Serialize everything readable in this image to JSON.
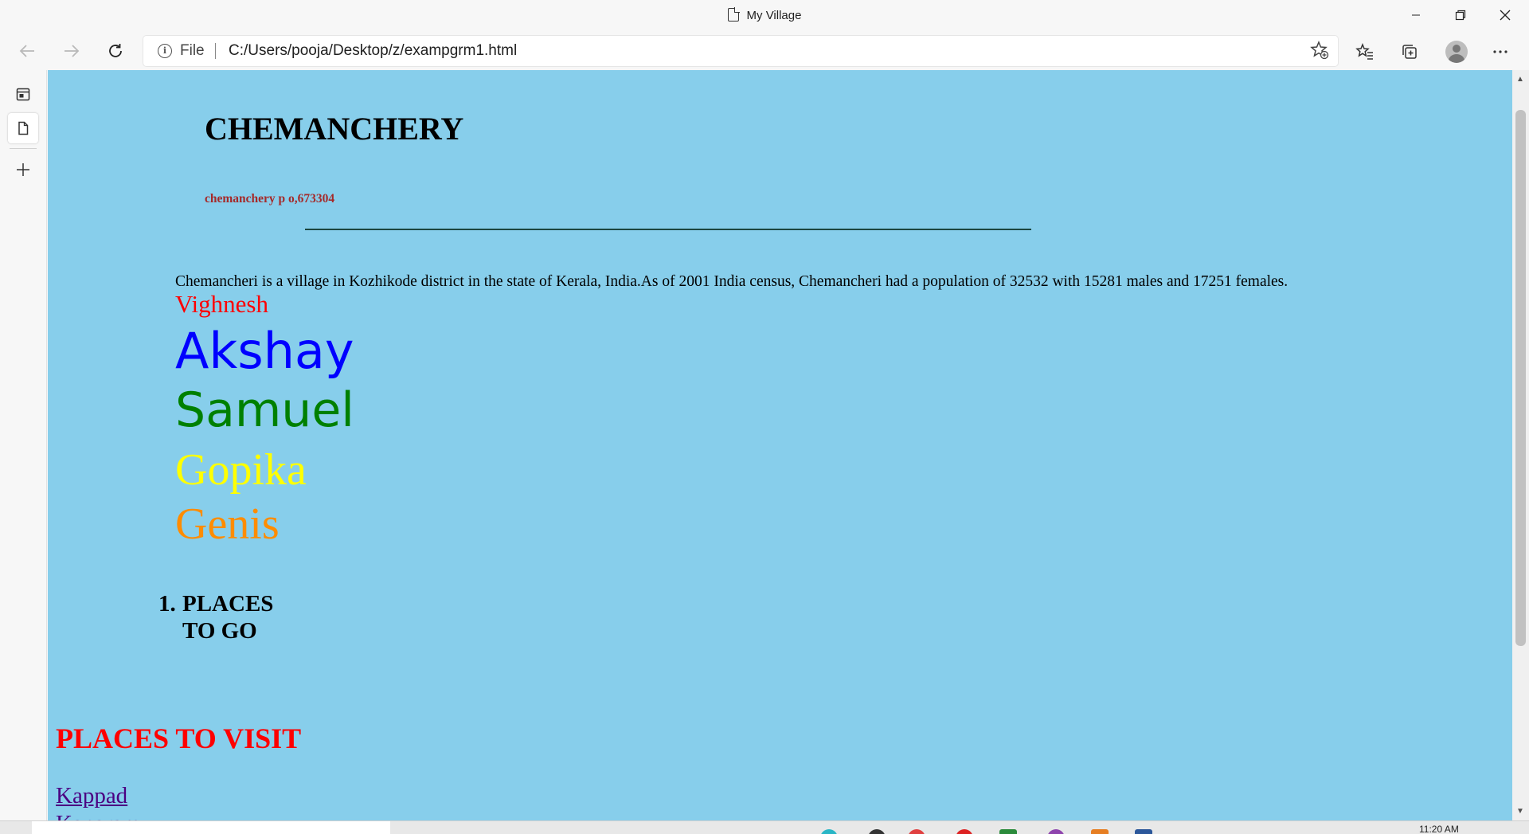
{
  "window": {
    "title": "My Village",
    "minimize_icon": "minimize-icon",
    "restore_icon": "restore-icon",
    "close_icon": "close-icon"
  },
  "toolbar": {
    "back_icon": "arrow-left-icon",
    "forward_icon": "arrow-right-icon",
    "refresh_icon": "refresh-icon",
    "scheme_label": "File",
    "url": "C:/Users/pooja/Desktop/z/exampgrm1.html",
    "icons": [
      "favorites-add-icon",
      "favorites-icon",
      "collections-icon",
      "profile-avatar",
      "more-icon"
    ]
  },
  "sidebar": {
    "icons": [
      "tab-actions-icon",
      "page-tab-icon",
      "new-tab-plus-icon"
    ]
  },
  "page": {
    "heading": "CHEMANCHERY",
    "address": "chemanchery p o,673304",
    "paragraph": "Chemancheri is a village in Kozhikode district in the state of Kerala, India.As of 2001 India census, Chemancheri had a population of 32532 with 15281 males and 17251 females.",
    "names": [
      {
        "text": "Vighnesh",
        "color": "#ff0000"
      },
      {
        "text": "Akshay",
        "color": "#0000ff"
      },
      {
        "text": "Samuel",
        "color": "#008000"
      },
      {
        "text": "Gopika",
        "color": "#ffff00"
      },
      {
        "text": "Genis",
        "color": "#ff8c00"
      }
    ],
    "ordered_list": [
      {
        "number": "1.",
        "line1": "PLACES",
        "line2": "TO GO"
      }
    ],
    "places_heading": "PLACES TO VISIT",
    "links": [
      "Kappad",
      "Kanaram"
    ],
    "background_color": "#87ceeb"
  },
  "taskbar": {
    "time": "11:20 AM"
  }
}
